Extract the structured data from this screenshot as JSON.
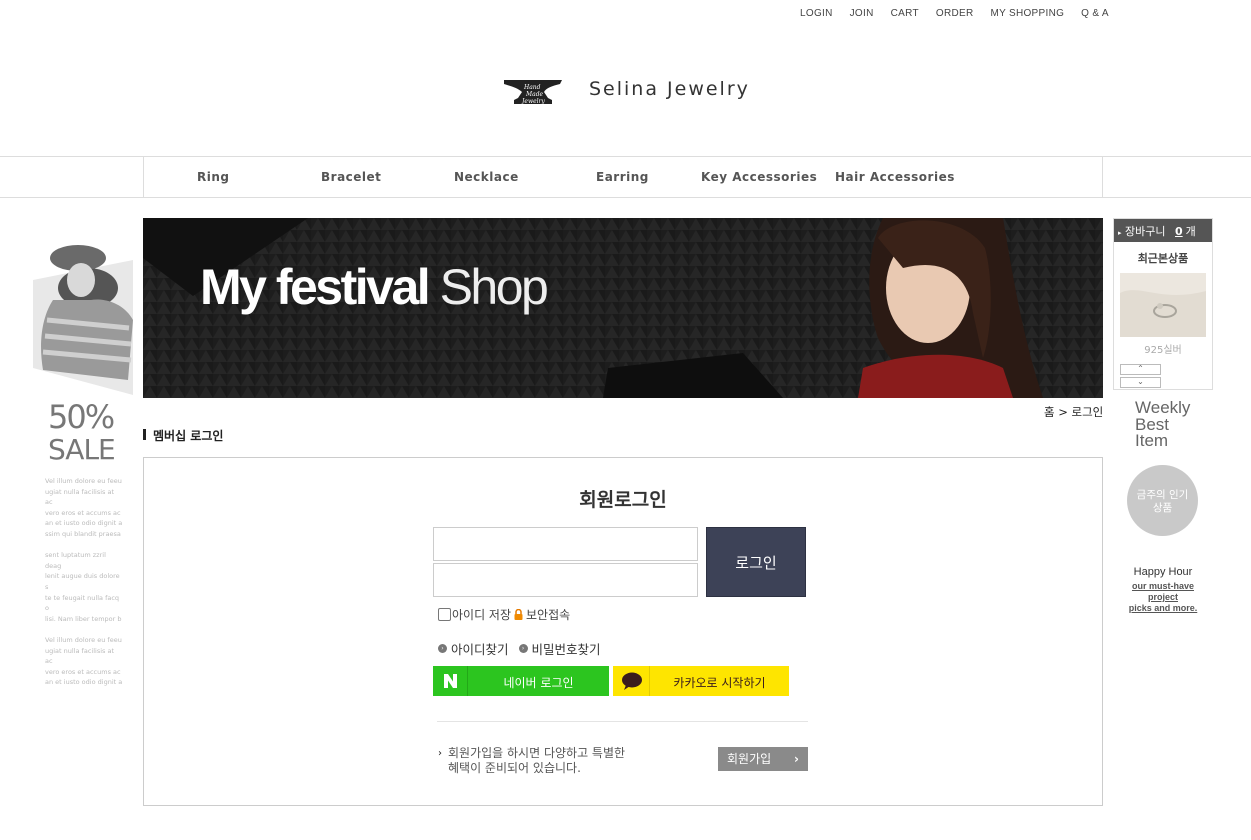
{
  "top_links": [
    "LOGIN",
    "JOIN",
    "CART",
    "ORDER",
    "MY SHOPPING",
    "Q & A"
  ],
  "logo": {
    "name": "Selina Jewelry",
    "mark_text": [
      "Hand",
      "Made",
      "Jewelry"
    ]
  },
  "nav": [
    "Ring",
    "Bracelet",
    "Necklace",
    "Earring",
    "Key Accessories",
    "Hair Accessories"
  ],
  "left_promo": {
    "percent": "50%",
    "sale": "SALE",
    "lorem": "Vel illum dolore eu feeu\nugiat nulla facilisis at ac\nvero eros et accums ac\nan et iusto odio dignit a\nssim qui blandit praesa\n\nsent luptatum zzril deag\nlenit augue duis dolore s\nte te feugait nulla facq o\nlisi. Nam liber tempor b\n\nVel illum dolore eu feeu\nugiat nulla facilisis at ac\nvero eros et accums ac\nan et iusto odio dignit a"
  },
  "banner": {
    "title_bold": "My festival",
    "title_thin": "Shop"
  },
  "cart": {
    "label": "장바구니",
    "count": "0",
    "unit": "개",
    "recent_title": "최근본상품",
    "recent_item_name": "925실버",
    "up_icon": "chevron-up",
    "down_icon": "chevron-down"
  },
  "weekly": {
    "line1": "Weekly",
    "line2": "Best",
    "line3": "Item",
    "circle_line1": "금주의 인기",
    "circle_line2": "상품"
  },
  "happy_hour": {
    "title": "Happy Hour",
    "line1": "our must-have",
    "line2": "project",
    "line3": "picks and more."
  },
  "breadcrumb": "홈 > 로그인",
  "section_title": "멤버십 로그인",
  "login": {
    "heading": "회원로그인",
    "id_value": "",
    "pw_value": "",
    "login_button": "로그인",
    "save_id_label": "아이디 저장",
    "secure_label": "보안접속",
    "find_id": "아이디찾기",
    "find_pw": "비밀번호찾기",
    "naver_label": "네이버 로그인",
    "kakao_label": "카카오로 시작하기",
    "join_msg_line1": "회원가입을 하시면 다양하고 특별한",
    "join_msg_line2": "혜택이 준비되어 있습니다.",
    "join_button": "회원가입"
  },
  "colors": {
    "naver": "#2cc51f",
    "kakao": "#fee500",
    "login_button": "#3d4257",
    "banner_bg": "#1d1d1d"
  }
}
